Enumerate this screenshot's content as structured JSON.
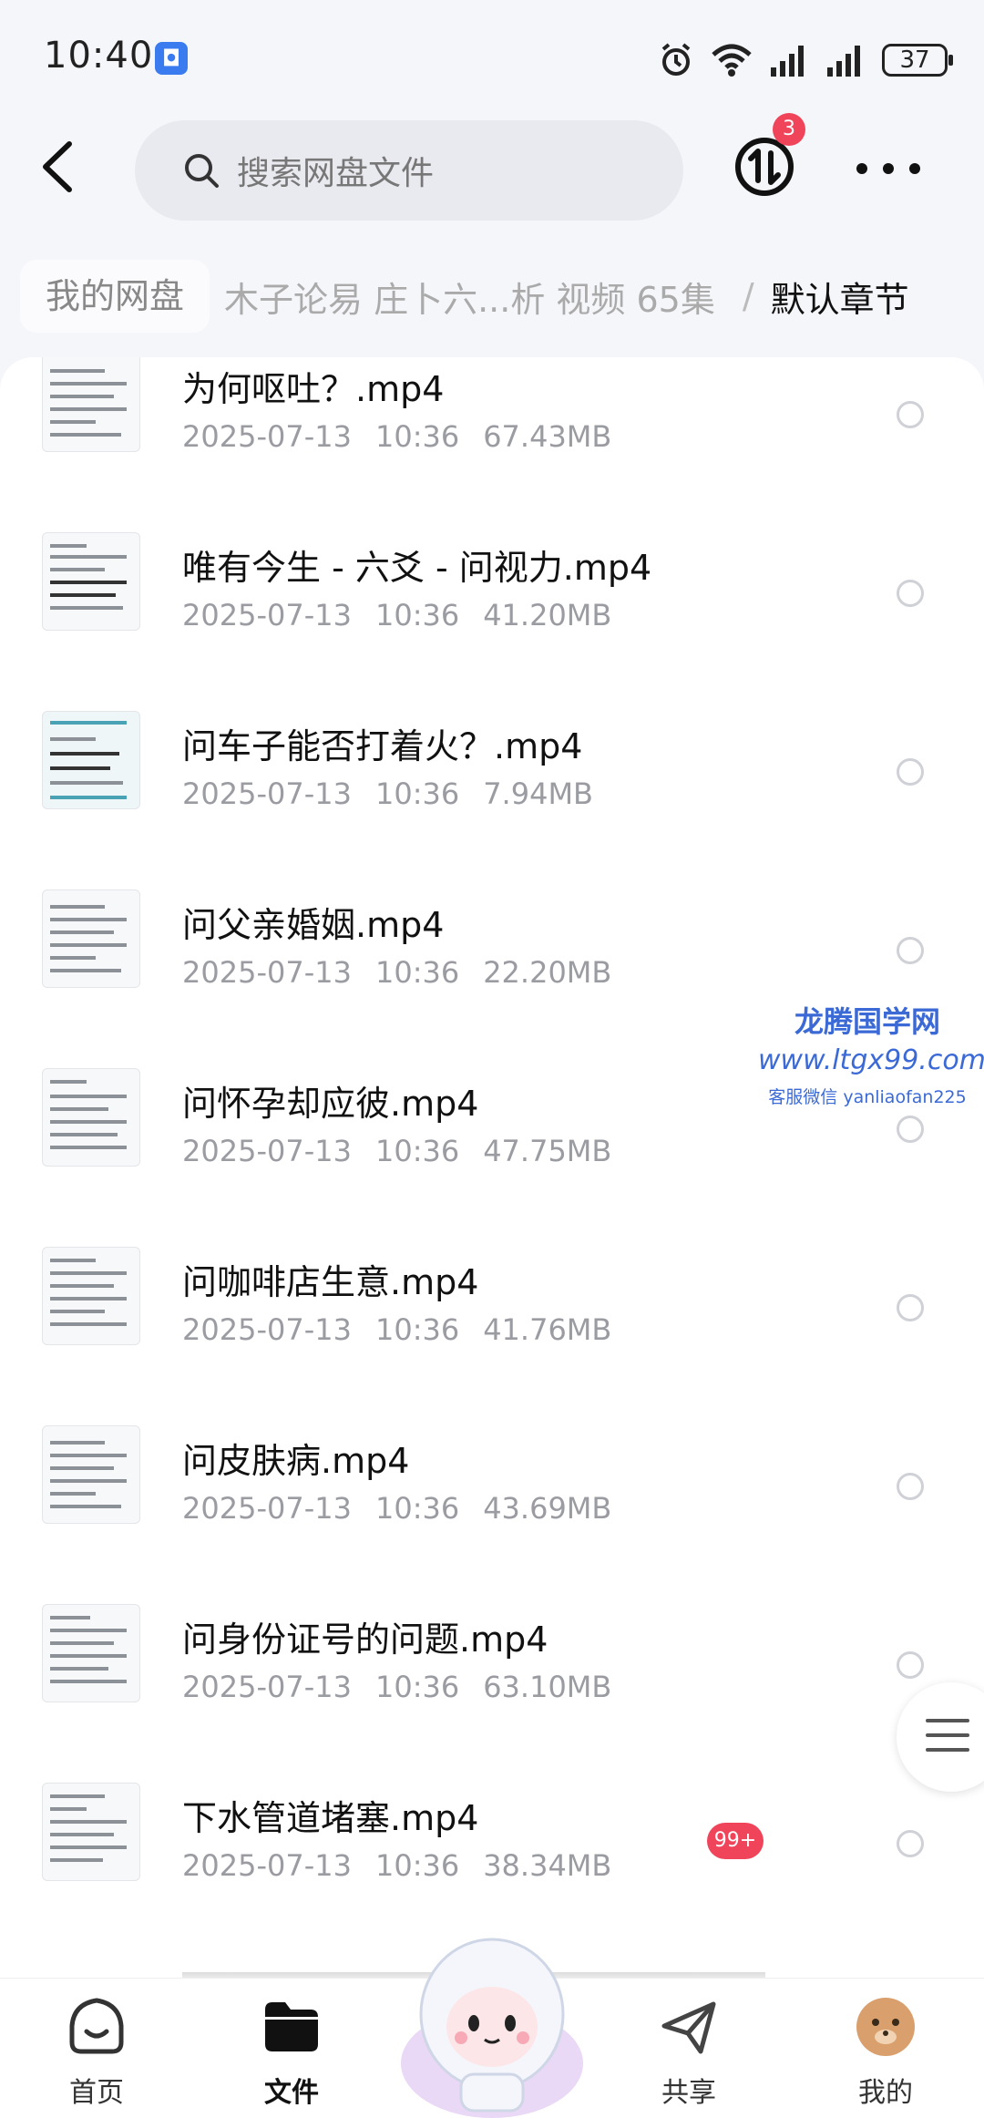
{
  "status_bar": {
    "time": "10:40",
    "battery": "37",
    "icons": [
      "app-notification-icon",
      "alarm-icon",
      "wifi-icon",
      "signal-icon",
      "signal-icon",
      "battery-icon"
    ]
  },
  "top_bar": {
    "search_placeholder": "搜索网盘文件",
    "transfer_badge": "3"
  },
  "breadcrumb": {
    "root": "我的网盘",
    "middle": "木子论易 庄卜六...析 视频 65集",
    "separator": "/",
    "current": "默认章节"
  },
  "files": [
    {
      "name": "为何呕吐？.mp4",
      "date": "2025-07-13",
      "time": "10:36",
      "size": "67.43MB"
    },
    {
      "name": "唯有今生 - 六爻 - 问视力.mp4",
      "date": "2025-07-13",
      "time": "10:36",
      "size": "41.20MB"
    },
    {
      "name": "问车子能否打着火？.mp4",
      "date": "2025-07-13",
      "time": "10:36",
      "size": "7.94MB"
    },
    {
      "name": "问父亲婚姻.mp4",
      "date": "2025-07-13",
      "time": "10:36",
      "size": "22.20MB"
    },
    {
      "name": "问怀孕却应彼.mp4",
      "date": "2025-07-13",
      "time": "10:36",
      "size": "47.75MB"
    },
    {
      "name": "问咖啡店生意.mp4",
      "date": "2025-07-13",
      "time": "10:36",
      "size": "41.76MB"
    },
    {
      "name": "问皮肤病.mp4",
      "date": "2025-07-13",
      "time": "10:36",
      "size": "43.69MB"
    },
    {
      "name": "问身份证号的问题.mp4",
      "date": "2025-07-13",
      "time": "10:36",
      "size": "63.10MB"
    },
    {
      "name": "下水管道堵塞.mp4",
      "date": "2025-07-13",
      "time": "10:36",
      "size": "38.34MB"
    }
  ],
  "watermark": {
    "title": "龙腾国学网",
    "url": "www.ltgx99.com",
    "contact": "客服微信 yanliaofan225"
  },
  "bottom_nav": {
    "home": "首页",
    "files": "文件",
    "share": "共享",
    "share_badge": "99+",
    "me": "我的"
  },
  "colors": {
    "accent_badge": "#f0445a",
    "watermark_blue": "#3b6ad6"
  }
}
